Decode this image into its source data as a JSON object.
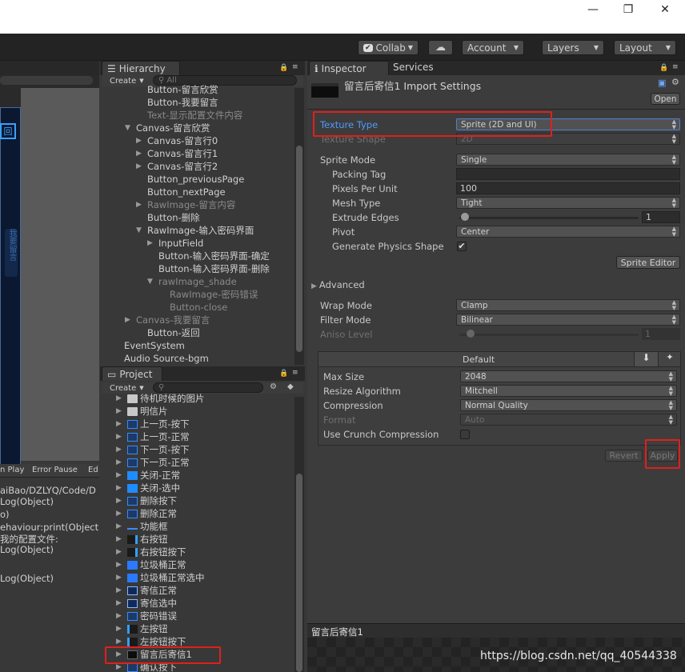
{
  "window": {
    "minimize": "—",
    "maximize": "❐",
    "close": "✕"
  },
  "toolbar": {
    "collab": "Collab",
    "account": "Account",
    "layers": "Layers",
    "layout": "Layout"
  },
  "hierarchy": {
    "tab": "Hierarchy",
    "create": "Create",
    "search_placeholder": "All",
    "items": [
      {
        "label": "Button-留言欣赏",
        "indent": 1,
        "arrow": "",
        "dim": false
      },
      {
        "label": "Button-我要留言",
        "indent": 1,
        "arrow": "",
        "dim": false
      },
      {
        "label": "Text-显示配置文件内容",
        "indent": 1,
        "arrow": "",
        "dim": true
      },
      {
        "label": "Canvas-留言欣赏",
        "indent": 0,
        "arrow": "▼",
        "dim": false
      },
      {
        "label": "Canvas-留言行0",
        "indent": 1,
        "arrow": "▶",
        "dim": false
      },
      {
        "label": "Canvas-留言行1",
        "indent": 1,
        "arrow": "▶",
        "dim": false
      },
      {
        "label": "Canvas-留言行2",
        "indent": 1,
        "arrow": "▶",
        "dim": false
      },
      {
        "label": "Button_previousPage",
        "indent": 1,
        "arrow": "",
        "dim": false
      },
      {
        "label": "Button_nextPage",
        "indent": 1,
        "arrow": "",
        "dim": false
      },
      {
        "label": "RawImage-留言内容",
        "indent": 1,
        "arrow": "▶",
        "dim": true
      },
      {
        "label": "Button-删除",
        "indent": 1,
        "arrow": "",
        "dim": false
      },
      {
        "label": "RawImage-输入密码界面",
        "indent": 1,
        "arrow": "▼",
        "dim": false
      },
      {
        "label": "InputField",
        "indent": 2,
        "arrow": "▶",
        "dim": false
      },
      {
        "label": "Button-输入密码界面-确定",
        "indent": 2,
        "arrow": "",
        "dim": false
      },
      {
        "label": "Button-输入密码界面-删除",
        "indent": 2,
        "arrow": "",
        "dim": false
      },
      {
        "label": "rawImage_shade",
        "indent": 2,
        "arrow": "▼",
        "dim": true
      },
      {
        "label": "RawImage-密码错误",
        "indent": 3,
        "arrow": "",
        "dim": true
      },
      {
        "label": "Button-close",
        "indent": 3,
        "arrow": "",
        "dim": true
      },
      {
        "label": "Canvas-我要留言",
        "indent": 0,
        "arrow": "▶",
        "dim": true
      },
      {
        "label": "Button-返回",
        "indent": 1,
        "arrow": "",
        "dim": false
      },
      {
        "label": "EventSystem",
        "indent": -1,
        "arrow": "",
        "dim": false
      },
      {
        "label": "Audio Source-bgm",
        "indent": -1,
        "arrow": "",
        "dim": false
      }
    ]
  },
  "project": {
    "tab": "Project",
    "create": "Create",
    "items": [
      {
        "label": "待机时候的图片",
        "icon": "folder"
      },
      {
        "label": "明信片",
        "icon": "folder"
      },
      {
        "label": "上一页-按下",
        "icon": "sprite"
      },
      {
        "label": "上一页-正常",
        "icon": "sprite"
      },
      {
        "label": "下一页-按下",
        "icon": "sprite"
      },
      {
        "label": "下一页-正常",
        "icon": "sprite"
      },
      {
        "label": "关闭-正常",
        "icon": "x"
      },
      {
        "label": "关闭-选中",
        "icon": "x"
      },
      {
        "label": "删除按下",
        "icon": "sprite"
      },
      {
        "label": "删除正常",
        "icon": "sprite"
      },
      {
        "label": "功能框",
        "icon": "line"
      },
      {
        "label": "右按钮",
        "icon": "chev"
      },
      {
        "label": "右按钮按下",
        "icon": "chev"
      },
      {
        "label": "垃圾桶正常",
        "icon": "trash"
      },
      {
        "label": "垃圾桶正常选中",
        "icon": "trash"
      },
      {
        "label": "寄信正常",
        "icon": "robot"
      },
      {
        "label": "寄信选中",
        "icon": "robot"
      },
      {
        "label": "密码错误",
        "icon": "sprite"
      },
      {
        "label": "左按钮",
        "icon": "chevl"
      },
      {
        "label": "左按钮按下",
        "icon": "chevl"
      },
      {
        "label": "留言后寄信1",
        "icon": "dark"
      },
      {
        "label": "确认按下",
        "icon": "sprite"
      }
    ]
  },
  "console": {
    "tabs": [
      "n Play",
      "Error Pause",
      "Ed"
    ],
    "lines": [
      "aiBao/DZLYQ/Code/D",
      "Log(Object)",
      "o)",
      "ehaviour:print(Object",
      "我的配置文件:",
      "Log(Object)",
      "",
      "Log(Object)"
    ]
  },
  "inspector": {
    "tab": "Inspector",
    "tab2": "Services",
    "title": "留言后寄信1 Import Settings",
    "open": "Open",
    "texture_type_label": "Texture Type",
    "texture_type": "Sprite (2D and UI)",
    "texture_shape_label": "Texture Shape",
    "texture_shape": "2D",
    "sprite_mode_label": "Sprite Mode",
    "sprite_mode": "Single",
    "packing_tag_label": "Packing Tag",
    "packing_tag": "",
    "ppu_label": "Pixels Per Unit",
    "ppu": "100",
    "mesh_type_label": "Mesh Type",
    "mesh_type": "Tight",
    "extrude_label": "Extrude Edges",
    "extrude": "1",
    "pivot_label": "Pivot",
    "pivot": "Center",
    "physics_label": "Generate Physics Shape",
    "physics": true,
    "sprite_editor": "Sprite Editor",
    "advanced": "Advanced",
    "wrap_label": "Wrap Mode",
    "wrap": "Clamp",
    "filter_label": "Filter Mode",
    "filter": "Bilinear",
    "aniso_label": "Aniso Level",
    "aniso": "1",
    "platform_tab": "Default",
    "max_size_label": "Max Size",
    "max_size": "2048",
    "resize_label": "Resize Algorithm",
    "resize": "Mitchell",
    "compression_label": "Compression",
    "compression": "Normal Quality",
    "format_label": "Format",
    "format": "Auto",
    "crunch_label": "Use Crunch Compression",
    "crunch": false,
    "revert": "Revert",
    "apply": "Apply",
    "preview_title": "留言后寄信1"
  },
  "watermark": "https://blog.csdn.net/qq_40544338"
}
